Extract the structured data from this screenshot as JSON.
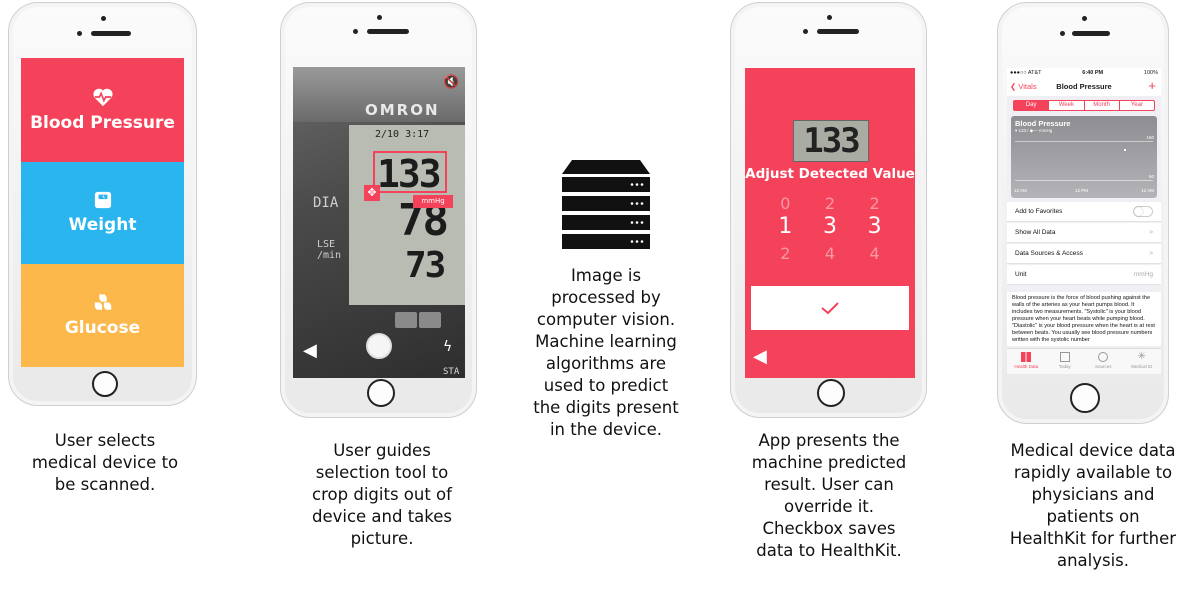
{
  "steps": [
    {
      "caption": "User selects medical device to be scanned.",
      "tiles": [
        {
          "label": "Blood Pressure",
          "icon": "heart-pulse-icon",
          "color": "#f4425a"
        },
        {
          "label": "Weight",
          "icon": "scale-icon",
          "color": "#2bb5ee"
        },
        {
          "label": "Glucose",
          "icon": "cubes-icon",
          "color": "#fcb84a"
        }
      ]
    },
    {
      "caption": "User guides selection tool to crop digits out of device and takes picture.",
      "brand": "OMRON",
      "reading": {
        "sys": "133",
        "dia": "78",
        "pulse": "73"
      },
      "side_labels": {
        "dia": "DIA",
        "pulse": "LSE\n/min",
        "bottom": "STA"
      },
      "unit_badge": "mmHg",
      "date_display": "2/10  3:17"
    },
    {
      "caption": "Image is processed by computer vision. Machine learning algorithms are used to predict the digits present in the device.",
      "icon": "server-icon"
    },
    {
      "caption": "App presents the machine predicted result. User can override it. Checkbox saves data to HealthKit.",
      "detected_value": "133",
      "title": "Adjust Detected Value",
      "picker": {
        "above": [
          "0",
          "2",
          "2"
        ],
        "selected": [
          "1",
          "3",
          "3"
        ],
        "below": [
          "2",
          "4",
          "4"
        ]
      },
      "accent": "#f4425a"
    },
    {
      "caption": "Medical device data rapidly available to physicians and patients on HealthKit for further analysis.",
      "status": {
        "carrier": "●●●○○ AT&T",
        "time": "6:40 PM",
        "battery": "100%"
      },
      "nav": {
        "back": "Vitals",
        "title": "Blood Pressure",
        "add": "+"
      },
      "segments": [
        "Day",
        "Week",
        "Month",
        "Year"
      ],
      "chart": {
        "title": "Blood Pressure",
        "subtitle": "▾ 133 / ◆— mmHg",
        "y_labels": [
          "160",
          "60"
        ],
        "x_labels": [
          "12 AM",
          "12 PM",
          "12 AM"
        ]
      },
      "rows": [
        {
          "label": "Add to Favorites",
          "right": ""
        },
        {
          "label": "Show All Data",
          "right": ">"
        },
        {
          "label": "Data Sources & Access",
          "right": ">"
        },
        {
          "label": "Unit",
          "right": "mmHg"
        }
      ],
      "description": "Blood pressure is the force of blood pushing against the walls of the arteries as your heart pumps blood. It includes two measurements. \"Systolic\" is your blood pressure when your heart beats while pumping blood. \"Diastolic\" is your blood pressure when the heart is at rest between beats. You usually see blood pressure numbers written with the systolic number",
      "tabs": [
        "Health Data",
        "Today",
        "Sources",
        "Medical ID"
      ]
    }
  ]
}
